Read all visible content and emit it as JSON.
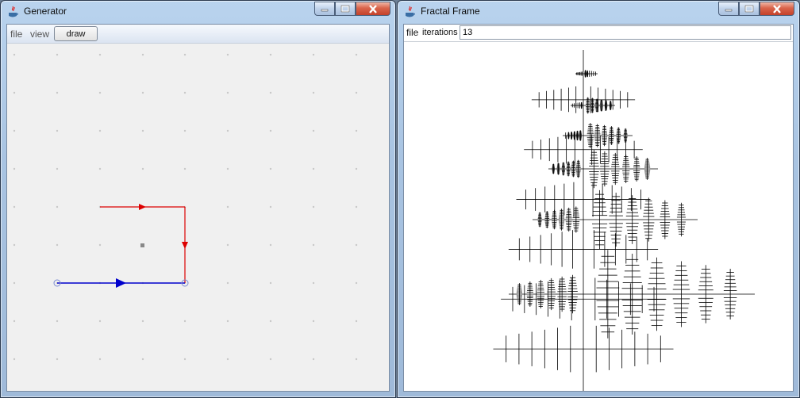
{
  "generator_window": {
    "title": "Generator",
    "menus": [
      "file",
      "view"
    ],
    "draw_button": "draw"
  },
  "fractal_window": {
    "title": "Fractal Frame",
    "menu_file": "file",
    "iterations_label": "iterations",
    "iterations_value": "13"
  },
  "colors": {
    "segment_red": "#dd0000",
    "segment_blue": "#0000cc",
    "grid_dot": "#c8c8c8",
    "fractal": "#000000"
  }
}
